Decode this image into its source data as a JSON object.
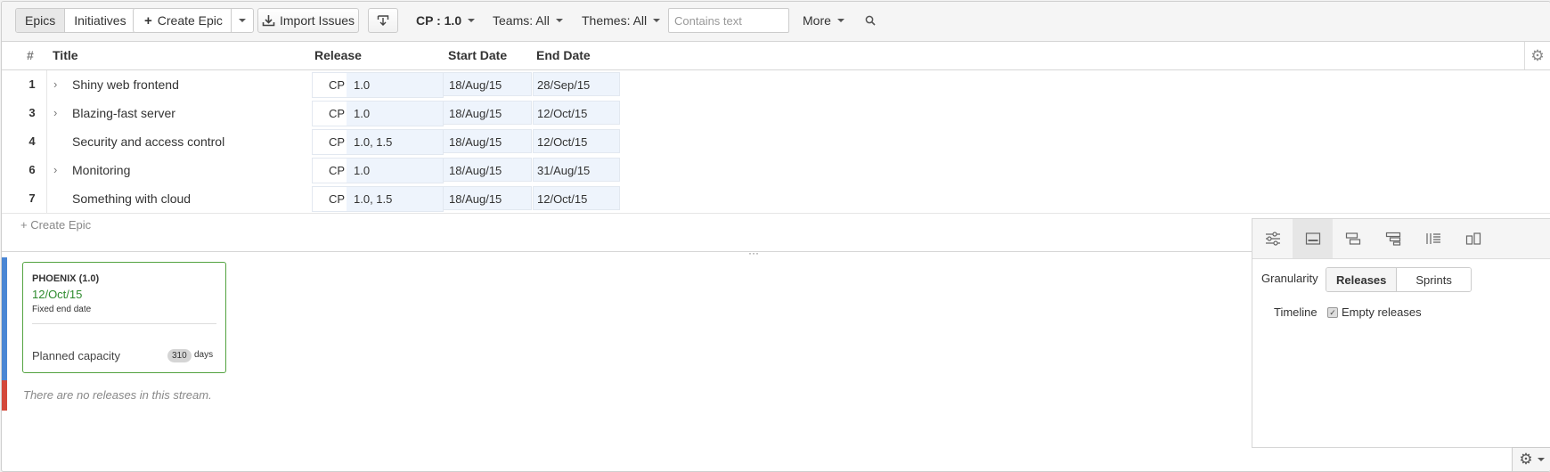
{
  "toolbar": {
    "view_tabs": [
      "Epics",
      "Initiatives"
    ],
    "create_epic_label": "Create Epic",
    "import_label": "Import Issues",
    "filter_cp": "CP : 1.0",
    "filter_teams": "Teams: All",
    "filter_themes": "Themes: All",
    "search_placeholder": "Contains text",
    "more_label": "More"
  },
  "table": {
    "headers": {
      "num": "#",
      "title": "Title",
      "release": "Release",
      "start": "Start Date",
      "end": "End Date"
    },
    "rows": [
      {
        "num": "1",
        "title": "Shiny web frontend",
        "expandable": true,
        "project": "CP",
        "release": "1.0",
        "start": "18/Aug/15",
        "end": "28/Sep/15"
      },
      {
        "num": "3",
        "title": "Blazing-fast server",
        "expandable": true,
        "project": "CP",
        "release": "1.0",
        "start": "18/Aug/15",
        "end": "12/Oct/15"
      },
      {
        "num": "4",
        "title": "Security and access control",
        "expandable": false,
        "project": "CP",
        "release": "1.0, 1.5",
        "start": "18/Aug/15",
        "end": "12/Oct/15"
      },
      {
        "num": "6",
        "title": "Monitoring",
        "expandable": true,
        "project": "CP",
        "release": "1.0",
        "start": "18/Aug/15",
        "end": "31/Aug/15"
      },
      {
        "num": "7",
        "title": "Something with cloud",
        "expandable": false,
        "project": "CP",
        "release": "1.0, 1.5",
        "start": "18/Aug/15",
        "end": "12/Oct/15"
      }
    ],
    "create_epic_link": "+ Create Epic"
  },
  "streams": {
    "release_card": {
      "name": "PHOENIX (1.0)",
      "date": "12/Oct/15",
      "subtitle": "Fixed end date",
      "capacity_label": "Planned capacity",
      "capacity_value": "310",
      "capacity_unit": "days"
    },
    "empty_message": "There are no releases in this stream.",
    "colors": {
      "stream1": "#4a86d4",
      "stream2": "#d4483a",
      "card_border": "#53a340"
    }
  },
  "settings_panel": {
    "granularity_label": "Granularity",
    "granularity_options": [
      "Releases",
      "Sprints"
    ],
    "granularity_selected": "Releases",
    "timeline_label": "Timeline",
    "empty_releases_label": "Empty releases",
    "empty_releases_checked": true
  }
}
